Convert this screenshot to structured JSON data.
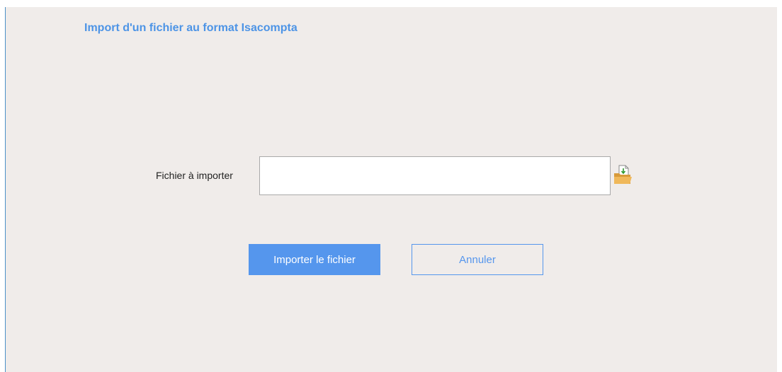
{
  "dialog": {
    "title": "Import d'un fichier au format Isacompta"
  },
  "form": {
    "file_label": "Fichier à importer",
    "file_value": "",
    "browse_icon": "folder-open-icon"
  },
  "actions": {
    "import_label": "Importer le fichier",
    "cancel_label": "Annuler"
  },
  "colors": {
    "accent": "#5596ed",
    "panel_background": "#f0ecea",
    "title": "#4d94e6"
  }
}
